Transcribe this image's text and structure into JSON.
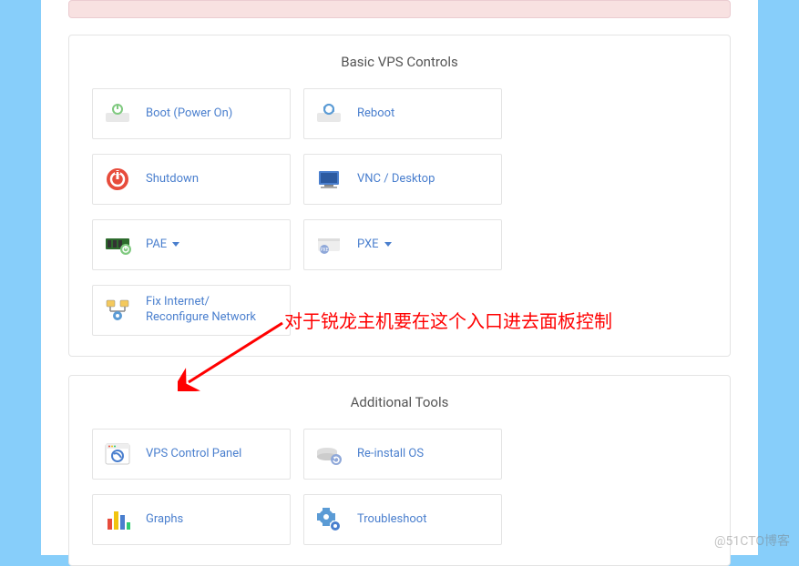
{
  "sections": {
    "basic": {
      "title": "Basic VPS Controls",
      "tiles": {
        "boot": "Boot (Power On)",
        "reboot": "Reboot",
        "shutdown": "Shutdown",
        "vnc": "VNC / Desktop",
        "pae": "PAE",
        "pxe": "PXE",
        "fixnet": "Fix Internet/\nReconfigure Network"
      }
    },
    "additional": {
      "title": "Additional Tools",
      "tiles": {
        "vpscp": "VPS Control Panel",
        "reinstall": "Re-install OS",
        "graphs": "Graphs",
        "troubleshoot": "Troubleshoot"
      }
    }
  },
  "annotation": "对于锐龙主机要在这个入口进去面板控制",
  "watermark": "@51CTO博客"
}
